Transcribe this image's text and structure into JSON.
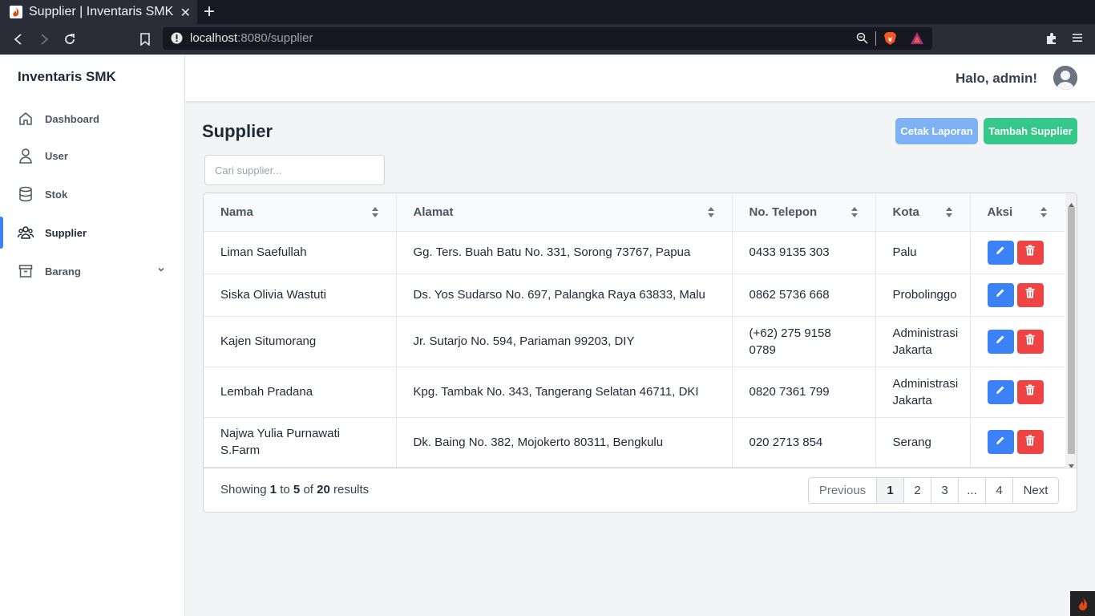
{
  "browser": {
    "tab_title": "Supplier | Inventaris SMK",
    "url_host": "localhost",
    "url_rest": ":8080/supplier"
  },
  "sidebar": {
    "brand": "Inventaris SMK",
    "items": [
      {
        "label": "Dashboard",
        "icon": "home-icon"
      },
      {
        "label": "User",
        "icon": "user-icon"
      },
      {
        "label": "Stok",
        "icon": "database-icon"
      },
      {
        "label": "Supplier",
        "icon": "users-group-icon",
        "active": true
      },
      {
        "label": "Barang",
        "icon": "archive-icon"
      }
    ]
  },
  "header": {
    "greeting": "Halo, admin!"
  },
  "page": {
    "title": "Supplier",
    "print_label": "Cetak Laporan",
    "add_label": "Tambah Supplier",
    "search_placeholder": "Cari supplier..."
  },
  "table": {
    "columns": [
      "Nama",
      "Alamat",
      "No. Telepon",
      "Kota",
      "Aksi"
    ],
    "rows": [
      {
        "nama": "Liman Saefullah",
        "alamat": "Gg. Ters. Buah Batu No. 331, Sorong 73767, Papua",
        "telepon": "0433 9135 303",
        "kota": "Palu"
      },
      {
        "nama": "Siska Olivia Wastuti",
        "alamat": "Ds. Yos Sudarso No. 697, Palangka Raya 63833, Malu",
        "telepon": "0862 5736 668",
        "kota": "Probolinggo"
      },
      {
        "nama": "Kajen Situmorang",
        "alamat": "Jr. Sutarjo No. 594, Pariaman 99203, DIY",
        "telepon": "(+62) 275 9158 0789",
        "kota": "Administrasi Jakarta"
      },
      {
        "nama": "Lembah Pradana",
        "alamat": "Kpg. Tambak No. 343, Tangerang Selatan 46711, DKI",
        "telepon": "0820 7361 799",
        "kota": "Administrasi Jakarta"
      },
      {
        "nama": "Najwa Yulia Purnawati S.Farm",
        "alamat": "Dk. Baing No. 382, Mojokerto 80311, Bengkulu",
        "telepon": "020 2713 854",
        "kota": "Serang"
      }
    ]
  },
  "pagination": {
    "showing_prefix": "Showing",
    "from": "1",
    "to_word": "to",
    "to": "5",
    "of_word": "of",
    "total": "20",
    "results_word": "results",
    "previous": "Previous",
    "pages": [
      "1",
      "2",
      "3",
      "...",
      "4"
    ],
    "current": "1",
    "next": "Next"
  },
  "colors": {
    "accent": "#3b82f6",
    "success": "#34c98a",
    "danger": "#ef4444"
  }
}
